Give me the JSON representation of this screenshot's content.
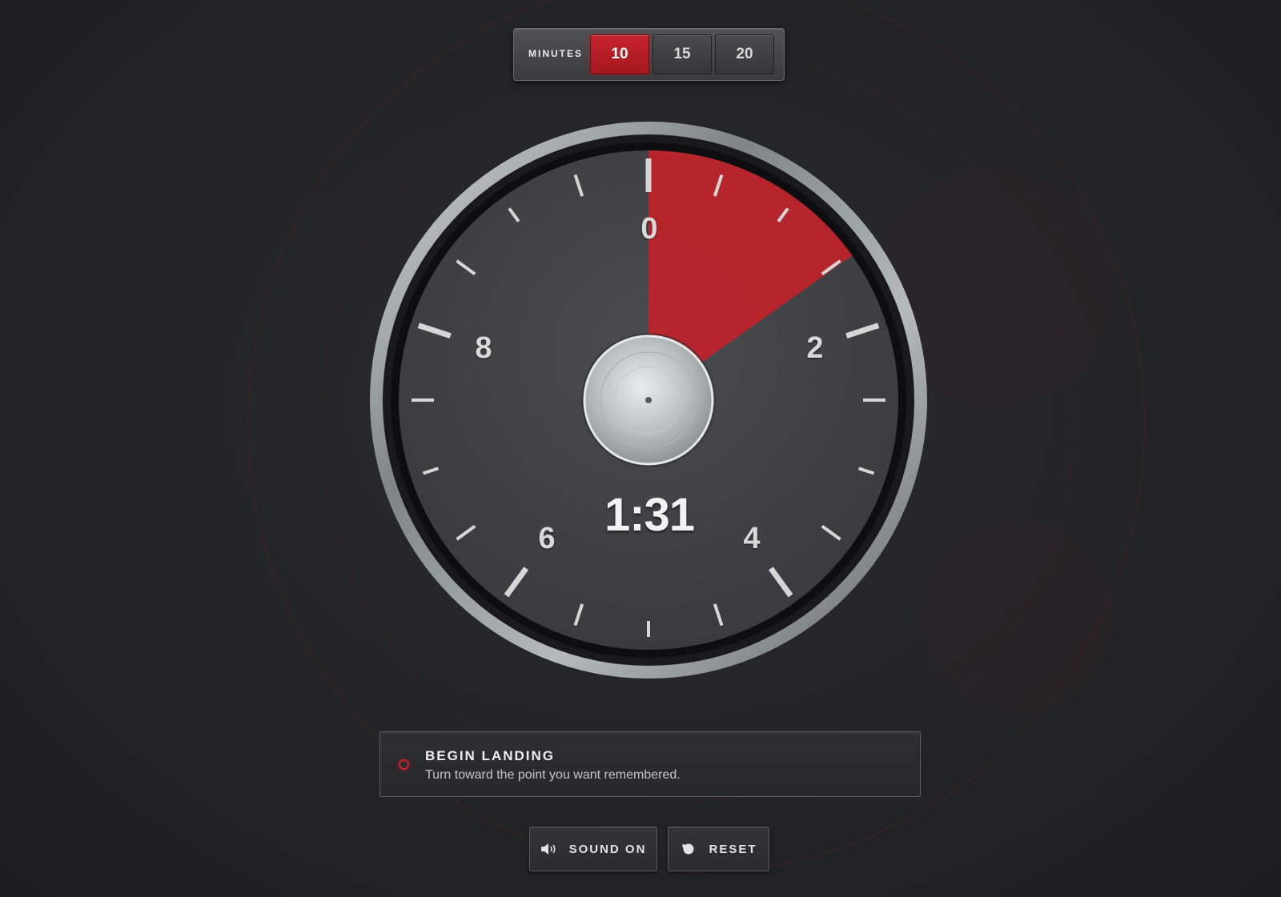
{
  "minutes": {
    "label": "MINUTES",
    "options": [
      "10",
      "15",
      "20"
    ],
    "selected": "10"
  },
  "dial": {
    "numbers": [
      "0",
      "2",
      "4",
      "6",
      "8"
    ],
    "countdown": "1:31",
    "remaining_fraction": 0.1517,
    "accent_color": "#c0222a"
  },
  "status": {
    "title": "BEGIN LANDING",
    "subtitle": "Turn toward the point you want remembered."
  },
  "controls": {
    "sound_label": "SOUND ON",
    "reset_label": "RESET"
  },
  "icons": {
    "sound": "speaker-icon",
    "reset": "reset-icon",
    "status": "status-indicator-icon"
  }
}
